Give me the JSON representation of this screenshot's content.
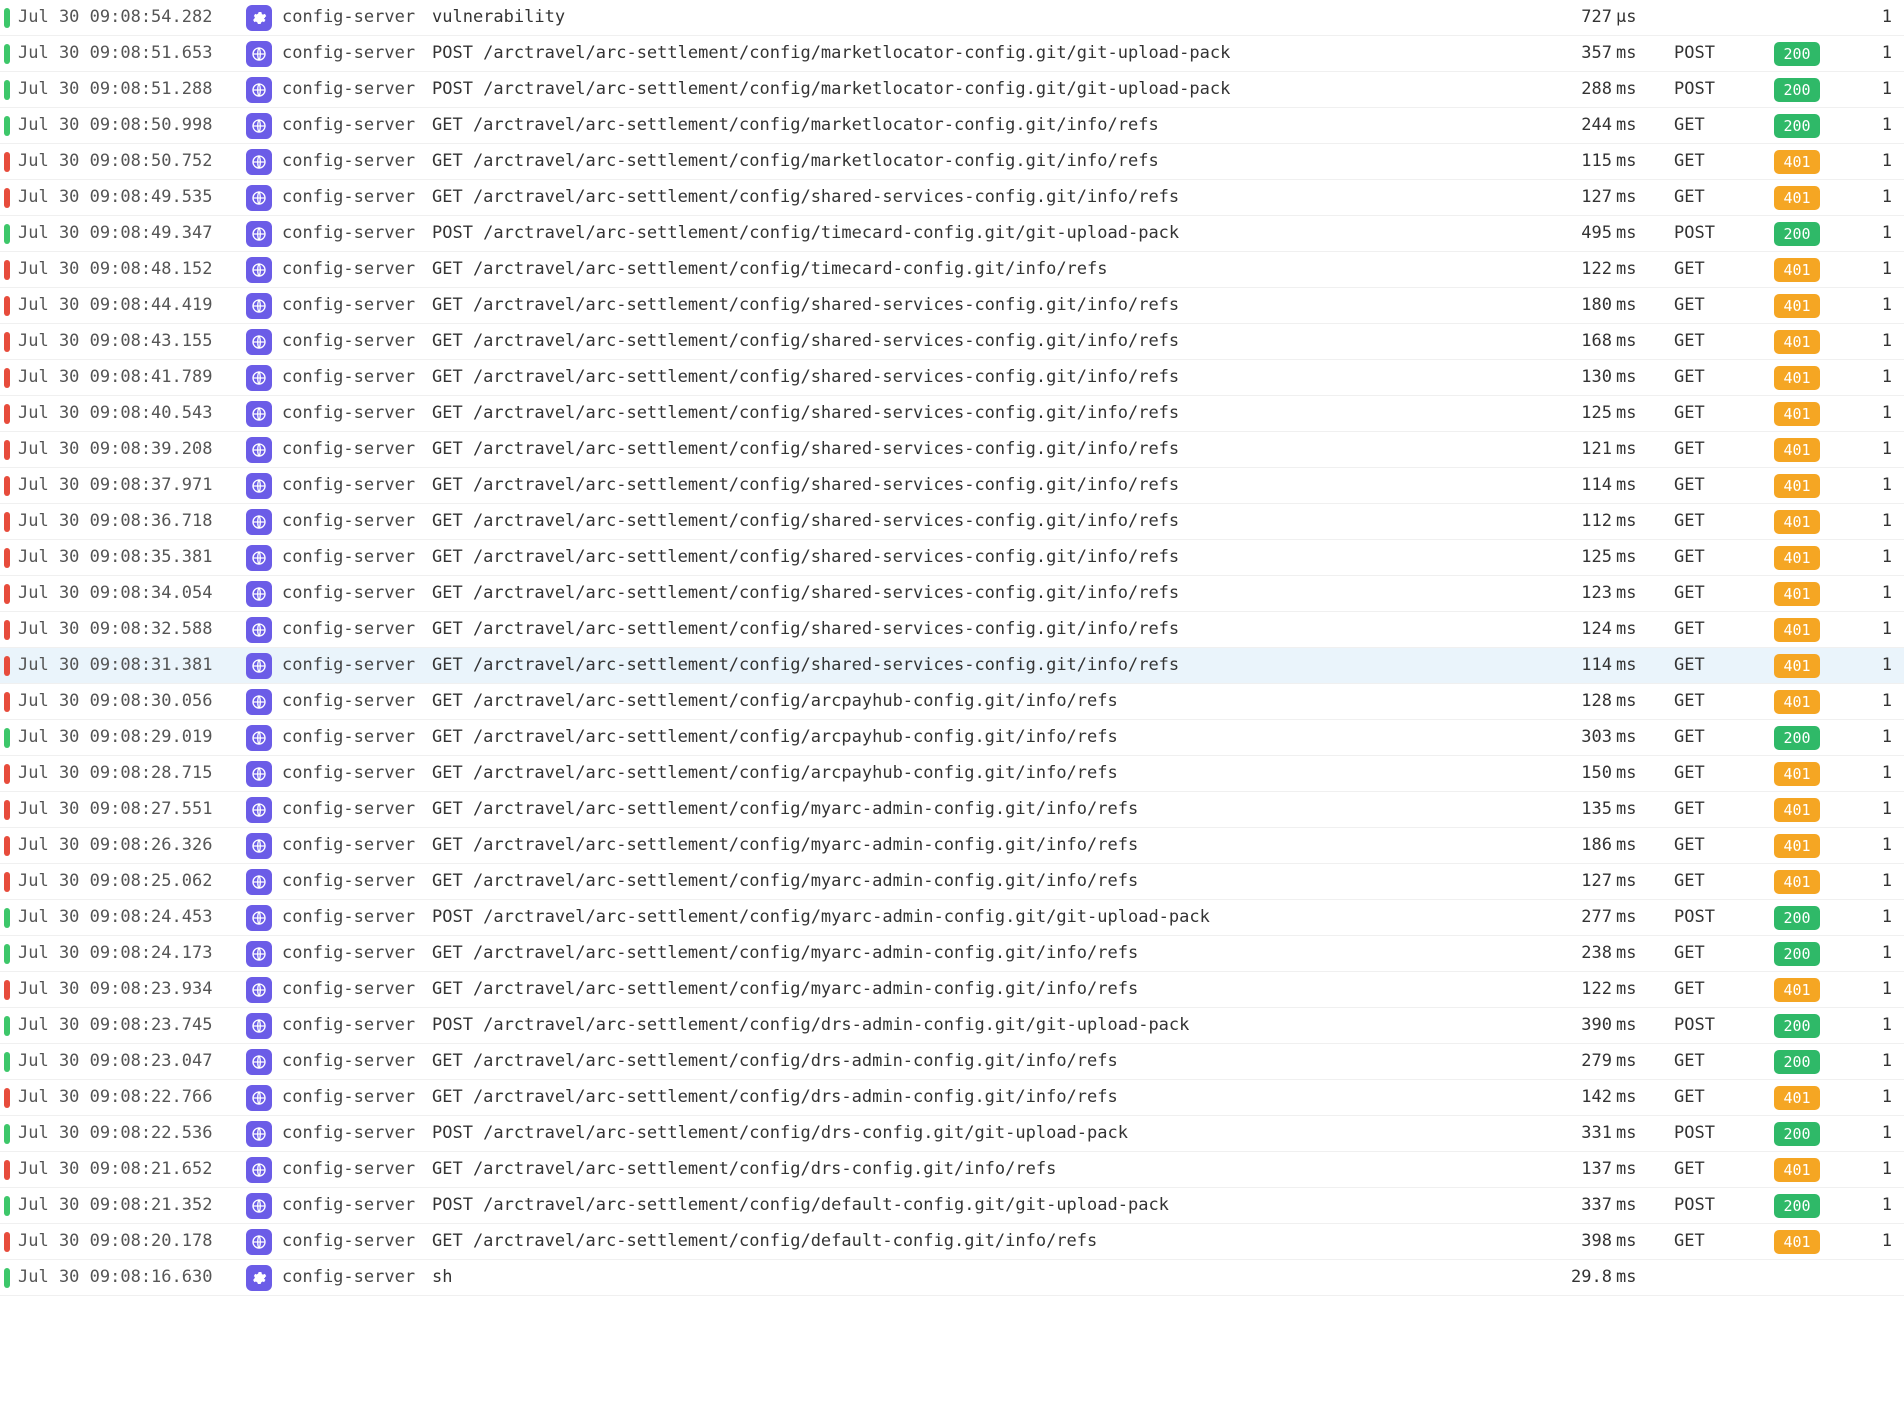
{
  "rows": [
    {
      "bar": "green",
      "ts": "Jul 30 09:08:54.282",
      "icon": "gear",
      "svc": "config-server",
      "desc": "vulnerability",
      "dur": "727",
      "unit": "µs",
      "method": "",
      "status": "",
      "count": "1",
      "hl": false
    },
    {
      "bar": "green",
      "ts": "Jul 30 09:08:51.653",
      "icon": "globe",
      "svc": "config-server",
      "desc": "POST /arctravel/arc-settlement/config/marketlocator-config.git/git-upload-pack",
      "dur": "357",
      "unit": "ms",
      "method": "POST",
      "status": "200",
      "count": "1",
      "hl": false
    },
    {
      "bar": "green",
      "ts": "Jul 30 09:08:51.288",
      "icon": "globe",
      "svc": "config-server",
      "desc": "POST /arctravel/arc-settlement/config/marketlocator-config.git/git-upload-pack",
      "dur": "288",
      "unit": "ms",
      "method": "POST",
      "status": "200",
      "count": "1",
      "hl": false
    },
    {
      "bar": "green",
      "ts": "Jul 30 09:08:50.998",
      "icon": "globe",
      "svc": "config-server",
      "desc": "GET /arctravel/arc-settlement/config/marketlocator-config.git/info/refs",
      "dur": "244",
      "unit": "ms",
      "method": "GET",
      "status": "200",
      "count": "1",
      "hl": false
    },
    {
      "bar": "red",
      "ts": "Jul 30 09:08:50.752",
      "icon": "globe",
      "svc": "config-server",
      "desc": "GET /arctravel/arc-settlement/config/marketlocator-config.git/info/refs",
      "dur": "115",
      "unit": "ms",
      "method": "GET",
      "status": "401",
      "count": "1",
      "hl": false
    },
    {
      "bar": "red",
      "ts": "Jul 30 09:08:49.535",
      "icon": "globe",
      "svc": "config-server",
      "desc": "GET /arctravel/arc-settlement/config/shared-services-config.git/info/refs",
      "dur": "127",
      "unit": "ms",
      "method": "GET",
      "status": "401",
      "count": "1",
      "hl": false
    },
    {
      "bar": "green",
      "ts": "Jul 30 09:08:49.347",
      "icon": "globe",
      "svc": "config-server",
      "desc": "POST /arctravel/arc-settlement/config/timecard-config.git/git-upload-pack",
      "dur": "495",
      "unit": "ms",
      "method": "POST",
      "status": "200",
      "count": "1",
      "hl": false
    },
    {
      "bar": "red",
      "ts": "Jul 30 09:08:48.152",
      "icon": "globe",
      "svc": "config-server",
      "desc": "GET /arctravel/arc-settlement/config/timecard-config.git/info/refs",
      "dur": "122",
      "unit": "ms",
      "method": "GET",
      "status": "401",
      "count": "1",
      "hl": false
    },
    {
      "bar": "red",
      "ts": "Jul 30 09:08:44.419",
      "icon": "globe",
      "svc": "config-server",
      "desc": "GET /arctravel/arc-settlement/config/shared-services-config.git/info/refs",
      "dur": "180",
      "unit": "ms",
      "method": "GET",
      "status": "401",
      "count": "1",
      "hl": false
    },
    {
      "bar": "red",
      "ts": "Jul 30 09:08:43.155",
      "icon": "globe",
      "svc": "config-server",
      "desc": "GET /arctravel/arc-settlement/config/shared-services-config.git/info/refs",
      "dur": "168",
      "unit": "ms",
      "method": "GET",
      "status": "401",
      "count": "1",
      "hl": false
    },
    {
      "bar": "red",
      "ts": "Jul 30 09:08:41.789",
      "icon": "globe",
      "svc": "config-server",
      "desc": "GET /arctravel/arc-settlement/config/shared-services-config.git/info/refs",
      "dur": "130",
      "unit": "ms",
      "method": "GET",
      "status": "401",
      "count": "1",
      "hl": false
    },
    {
      "bar": "red",
      "ts": "Jul 30 09:08:40.543",
      "icon": "globe",
      "svc": "config-server",
      "desc": "GET /arctravel/arc-settlement/config/shared-services-config.git/info/refs",
      "dur": "125",
      "unit": "ms",
      "method": "GET",
      "status": "401",
      "count": "1",
      "hl": false
    },
    {
      "bar": "red",
      "ts": "Jul 30 09:08:39.208",
      "icon": "globe",
      "svc": "config-server",
      "desc": "GET /arctravel/arc-settlement/config/shared-services-config.git/info/refs",
      "dur": "121",
      "unit": "ms",
      "method": "GET",
      "status": "401",
      "count": "1",
      "hl": false
    },
    {
      "bar": "red",
      "ts": "Jul 30 09:08:37.971",
      "icon": "globe",
      "svc": "config-server",
      "desc": "GET /arctravel/arc-settlement/config/shared-services-config.git/info/refs",
      "dur": "114",
      "unit": "ms",
      "method": "GET",
      "status": "401",
      "count": "1",
      "hl": false
    },
    {
      "bar": "red",
      "ts": "Jul 30 09:08:36.718",
      "icon": "globe",
      "svc": "config-server",
      "desc": "GET /arctravel/arc-settlement/config/shared-services-config.git/info/refs",
      "dur": "112",
      "unit": "ms",
      "method": "GET",
      "status": "401",
      "count": "1",
      "hl": false
    },
    {
      "bar": "red",
      "ts": "Jul 30 09:08:35.381",
      "icon": "globe",
      "svc": "config-server",
      "desc": "GET /arctravel/arc-settlement/config/shared-services-config.git/info/refs",
      "dur": "125",
      "unit": "ms",
      "method": "GET",
      "status": "401",
      "count": "1",
      "hl": false
    },
    {
      "bar": "red",
      "ts": "Jul 30 09:08:34.054",
      "icon": "globe",
      "svc": "config-server",
      "desc": "GET /arctravel/arc-settlement/config/shared-services-config.git/info/refs",
      "dur": "123",
      "unit": "ms",
      "method": "GET",
      "status": "401",
      "count": "1",
      "hl": false
    },
    {
      "bar": "red",
      "ts": "Jul 30 09:08:32.588",
      "icon": "globe",
      "svc": "config-server",
      "desc": "GET /arctravel/arc-settlement/config/shared-services-config.git/info/refs",
      "dur": "124",
      "unit": "ms",
      "method": "GET",
      "status": "401",
      "count": "1",
      "hl": false
    },
    {
      "bar": "red",
      "ts": "Jul 30 09:08:31.381",
      "icon": "globe",
      "svc": "config-server",
      "desc": "GET /arctravel/arc-settlement/config/shared-services-config.git/info/refs",
      "dur": "114",
      "unit": "ms",
      "method": "GET",
      "status": "401",
      "count": "1",
      "hl": true
    },
    {
      "bar": "red",
      "ts": "Jul 30 09:08:30.056",
      "icon": "globe",
      "svc": "config-server",
      "desc": "GET /arctravel/arc-settlement/config/arcpayhub-config.git/info/refs",
      "dur": "128",
      "unit": "ms",
      "method": "GET",
      "status": "401",
      "count": "1",
      "hl": false
    },
    {
      "bar": "green",
      "ts": "Jul 30 09:08:29.019",
      "icon": "globe",
      "svc": "config-server",
      "desc": "GET /arctravel/arc-settlement/config/arcpayhub-config.git/info/refs",
      "dur": "303",
      "unit": "ms",
      "method": "GET",
      "status": "200",
      "count": "1",
      "hl": false
    },
    {
      "bar": "red",
      "ts": "Jul 30 09:08:28.715",
      "icon": "globe",
      "svc": "config-server",
      "desc": "GET /arctravel/arc-settlement/config/arcpayhub-config.git/info/refs",
      "dur": "150",
      "unit": "ms",
      "method": "GET",
      "status": "401",
      "count": "1",
      "hl": false
    },
    {
      "bar": "red",
      "ts": "Jul 30 09:08:27.551",
      "icon": "globe",
      "svc": "config-server",
      "desc": "GET /arctravel/arc-settlement/config/myarc-admin-config.git/info/refs",
      "dur": "135",
      "unit": "ms",
      "method": "GET",
      "status": "401",
      "count": "1",
      "hl": false
    },
    {
      "bar": "red",
      "ts": "Jul 30 09:08:26.326",
      "icon": "globe",
      "svc": "config-server",
      "desc": "GET /arctravel/arc-settlement/config/myarc-admin-config.git/info/refs",
      "dur": "186",
      "unit": "ms",
      "method": "GET",
      "status": "401",
      "count": "1",
      "hl": false
    },
    {
      "bar": "red",
      "ts": "Jul 30 09:08:25.062",
      "icon": "globe",
      "svc": "config-server",
      "desc": "GET /arctravel/arc-settlement/config/myarc-admin-config.git/info/refs",
      "dur": "127",
      "unit": "ms",
      "method": "GET",
      "status": "401",
      "count": "1",
      "hl": false
    },
    {
      "bar": "green",
      "ts": "Jul 30 09:08:24.453",
      "icon": "globe",
      "svc": "config-server",
      "desc": "POST /arctravel/arc-settlement/config/myarc-admin-config.git/git-upload-pack",
      "dur": "277",
      "unit": "ms",
      "method": "POST",
      "status": "200",
      "count": "1",
      "hl": false
    },
    {
      "bar": "green",
      "ts": "Jul 30 09:08:24.173",
      "icon": "globe",
      "svc": "config-server",
      "desc": "GET /arctravel/arc-settlement/config/myarc-admin-config.git/info/refs",
      "dur": "238",
      "unit": "ms",
      "method": "GET",
      "status": "200",
      "count": "1",
      "hl": false
    },
    {
      "bar": "red",
      "ts": "Jul 30 09:08:23.934",
      "icon": "globe",
      "svc": "config-server",
      "desc": "GET /arctravel/arc-settlement/config/myarc-admin-config.git/info/refs",
      "dur": "122",
      "unit": "ms",
      "method": "GET",
      "status": "401",
      "count": "1",
      "hl": false
    },
    {
      "bar": "green",
      "ts": "Jul 30 09:08:23.745",
      "icon": "globe",
      "svc": "config-server",
      "desc": "POST /arctravel/arc-settlement/config/drs-admin-config.git/git-upload-pack",
      "dur": "390",
      "unit": "ms",
      "method": "POST",
      "status": "200",
      "count": "1",
      "hl": false
    },
    {
      "bar": "green",
      "ts": "Jul 30 09:08:23.047",
      "icon": "globe",
      "svc": "config-server",
      "desc": "GET /arctravel/arc-settlement/config/drs-admin-config.git/info/refs",
      "dur": "279",
      "unit": "ms",
      "method": "GET",
      "status": "200",
      "count": "1",
      "hl": false
    },
    {
      "bar": "red",
      "ts": "Jul 30 09:08:22.766",
      "icon": "globe",
      "svc": "config-server",
      "desc": "GET /arctravel/arc-settlement/config/drs-admin-config.git/info/refs",
      "dur": "142",
      "unit": "ms",
      "method": "GET",
      "status": "401",
      "count": "1",
      "hl": false
    },
    {
      "bar": "green",
      "ts": "Jul 30 09:08:22.536",
      "icon": "globe",
      "svc": "config-server",
      "desc": "POST /arctravel/arc-settlement/config/drs-config.git/git-upload-pack",
      "dur": "331",
      "unit": "ms",
      "method": "POST",
      "status": "200",
      "count": "1",
      "hl": false
    },
    {
      "bar": "red",
      "ts": "Jul 30 09:08:21.652",
      "icon": "globe",
      "svc": "config-server",
      "desc": "GET /arctravel/arc-settlement/config/drs-config.git/info/refs",
      "dur": "137",
      "unit": "ms",
      "method": "GET",
      "status": "401",
      "count": "1",
      "hl": false
    },
    {
      "bar": "green",
      "ts": "Jul 30 09:08:21.352",
      "icon": "globe",
      "svc": "config-server",
      "desc": "POST /arctravel/arc-settlement/config/default-config.git/git-upload-pack",
      "dur": "337",
      "unit": "ms",
      "method": "POST",
      "status": "200",
      "count": "1",
      "hl": false
    },
    {
      "bar": "red",
      "ts": "Jul 30 09:08:20.178",
      "icon": "globe",
      "svc": "config-server",
      "desc": "GET /arctravel/arc-settlement/config/default-config.git/info/refs",
      "dur": "398",
      "unit": "ms",
      "method": "GET",
      "status": "401",
      "count": "1",
      "hl": false
    },
    {
      "bar": "green",
      "ts": "Jul 30 09:08:16.630",
      "icon": "gear",
      "svc": "config-server",
      "desc": "sh",
      "dur": "29.8",
      "unit": "ms",
      "method": "",
      "status": "",
      "count": "",
      "hl": false
    }
  ]
}
